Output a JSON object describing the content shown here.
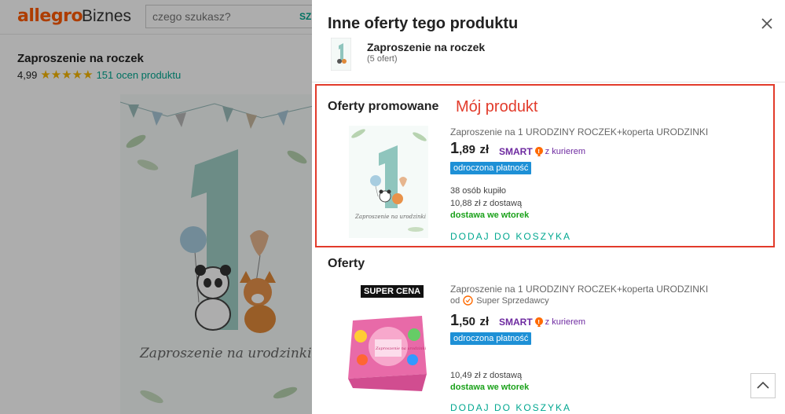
{
  "header": {
    "logo_text": "allegro",
    "logo_suffix": "Biznes",
    "search_placeholder": "czego szukasz?",
    "search_button_label": "SZU"
  },
  "background_product": {
    "title": "Zaproszenie na roczek",
    "rating": "4,99",
    "stars": "★★★★★",
    "reviews": "151 ocen produktu",
    "image_script_text": "Zaproszenie na urodzinki"
  },
  "panel": {
    "title": "Inne oferty tego produktu",
    "product_name": "Zaproszenie na roczek",
    "offer_count": "(5 ofert)",
    "promoted_title": "Oferty promowane",
    "annotation": "Mój produkt",
    "offers_title": "Oferty",
    "scroll_top_icon": "chevron-up-icon"
  },
  "promoted_offer": {
    "name": "Zaproszenie na 1 URODZINY ROCZEK+koperta URODZINKI",
    "price_main": "1",
    "price_decimal": ",89",
    "currency": "zł",
    "smart_label": "SMART",
    "courier": "z kurierem",
    "deferred_payment": "odroczona płatność",
    "bought": "38 osób kupiło",
    "with_delivery": "10,88 zł z dostawą",
    "delivery_day": "dostawa we wtorek",
    "add_to_cart": "DODAJ DO KOSZYKA",
    "image_text": "Zaproszenie na urodzinki"
  },
  "regular_offer": {
    "badge": "SUPER CENA",
    "name": "Zaproszenie na 1 URODZINY ROCZEK+koperta URODZINKI",
    "seller_prefix": "od",
    "seller": "Super Sprzedawcy",
    "price_main": "1",
    "price_decimal": ",50",
    "currency": "zł",
    "smart_label": "SMART",
    "courier": "z kurierem",
    "deferred_payment": "odroczona płatność",
    "with_delivery": "10,49 zł z dostawą",
    "delivery_day": "dostawa we wtorek",
    "add_to_cart": "DODAJ DO KOSZYKA",
    "image_text": "Zaproszenie na urodzinki"
  },
  "colors": {
    "brand": "#ff5a00",
    "accent": "#00a790",
    "annotation": "#e23b2b",
    "smart": "#6e2aa0",
    "deferred": "#1e90d6",
    "delivery": "#1aa11a"
  }
}
